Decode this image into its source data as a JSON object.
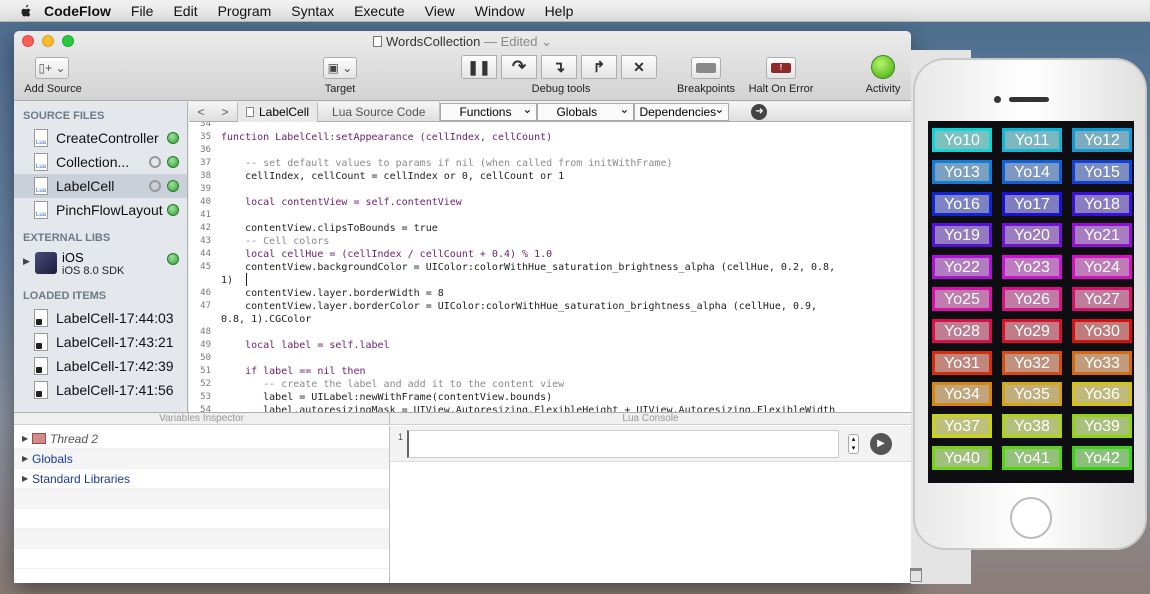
{
  "menubar": {
    "app": "CodeFlow",
    "items": [
      "File",
      "Edit",
      "Program",
      "Syntax",
      "Execute",
      "View",
      "Window",
      "Help"
    ]
  },
  "window": {
    "title": "WordsCollection",
    "edited": "— Edited"
  },
  "toolbar": {
    "add_source": "Add Source",
    "target": "Target",
    "debug_tools": "Debug tools",
    "breakpoints": "Breakpoints",
    "halt_on_error": "Halt On Error",
    "activity": "Activity"
  },
  "sidebar": {
    "source_files_header": "SOURCE FILES",
    "source_files": [
      "CreateController",
      "Collection...",
      "LabelCell",
      "PinchFlowLayout"
    ],
    "external_libs_header": "EXTERNAL LIBS",
    "ios_name": "iOS",
    "ios_sdk": "iOS 8.0 SDK",
    "loaded_items_header": "LOADED ITEMS",
    "loaded_items": [
      "LabelCell-17:44:03",
      "LabelCell-17:43:21",
      "LabelCell-17:42:39",
      "LabelCell-17:41:56"
    ]
  },
  "nav": {
    "file_tab": "LabelCell",
    "source_tab": "Lua Source Code",
    "functions": "Functions",
    "globals": "Globals",
    "dependencies": "Dependencies"
  },
  "code": {
    "line_numbers": [
      "34",
      "35",
      "36",
      "37",
      "38",
      "39",
      "40",
      "41",
      "42",
      "43",
      "44",
      "45",
      "",
      "46",
      "47",
      "",
      "48",
      "49",
      "50",
      "51",
      "52",
      "53",
      "54"
    ],
    "lines": [
      "",
      "function LabelCell:setAppearance (cellIndex, cellCount)",
      "",
      "    -- set default values to params if nil (when called from initWithFrame)",
      "    cellIndex, cellCount = cellIndex or 0, cellCount or 1",
      "",
      "    local contentView = self.contentView",
      "",
      "    contentView.clipsToBounds = true",
      "    -- Cell colors",
      "    local cellHue = (cellIndex / cellCount + 0.4) % 1.0",
      "    contentView.backgroundColor = UIColor:colorWithHue_saturation_brightness_alpha (cellHue, 0.2, 0.8,",
      "1)",
      "    contentView.layer.borderWidth = 8",
      "    contentView.layer.borderColor = UIColor:colorWithHue_saturation_brightness_alpha (cellHue, 0.9,",
      "0.8, 1).CGColor",
      "",
      "    local label = self.label",
      "",
      "    if label == nil then",
      "       -- create the label and add it to the content view",
      "       label = UILabel:newWithFrame(contentView.bounds)",
      "       label.autoresizingMask = UIView.Autoresizing.FlexibleHeight + UIView.Autoresizing.FlexibleWidth"
    ]
  },
  "variables": {
    "header": "Variables Inspector",
    "rows": [
      "Thread 2",
      "Globals",
      "Standard Libraries"
    ]
  },
  "console": {
    "header": "Lua Console",
    "line": "1"
  },
  "phone": {
    "cells": [
      "Yo10",
      "Yo11",
      "Yo12",
      "Yo13",
      "Yo14",
      "Yo15",
      "Yo16",
      "Yo17",
      "Yo18",
      "Yo19",
      "Yo20",
      "Yo21",
      "Yo22",
      "Yo23",
      "Yo24",
      "Yo25",
      "Yo26",
      "Yo27",
      "Yo28",
      "Yo29",
      "Yo30",
      "Yo31",
      "Yo32",
      "Yo33",
      "Yo34",
      "Yo35",
      "Yo36",
      "Yo37",
      "Yo38",
      "Yo39",
      "Yo40",
      "Yo41",
      "Yo42"
    ]
  },
  "colors": {
    "accent_green": "#2c9f2c",
    "traffic_red": "#fc5f57",
    "traffic_yellow": "#fdbc2e",
    "traffic_green": "#28c940"
  }
}
